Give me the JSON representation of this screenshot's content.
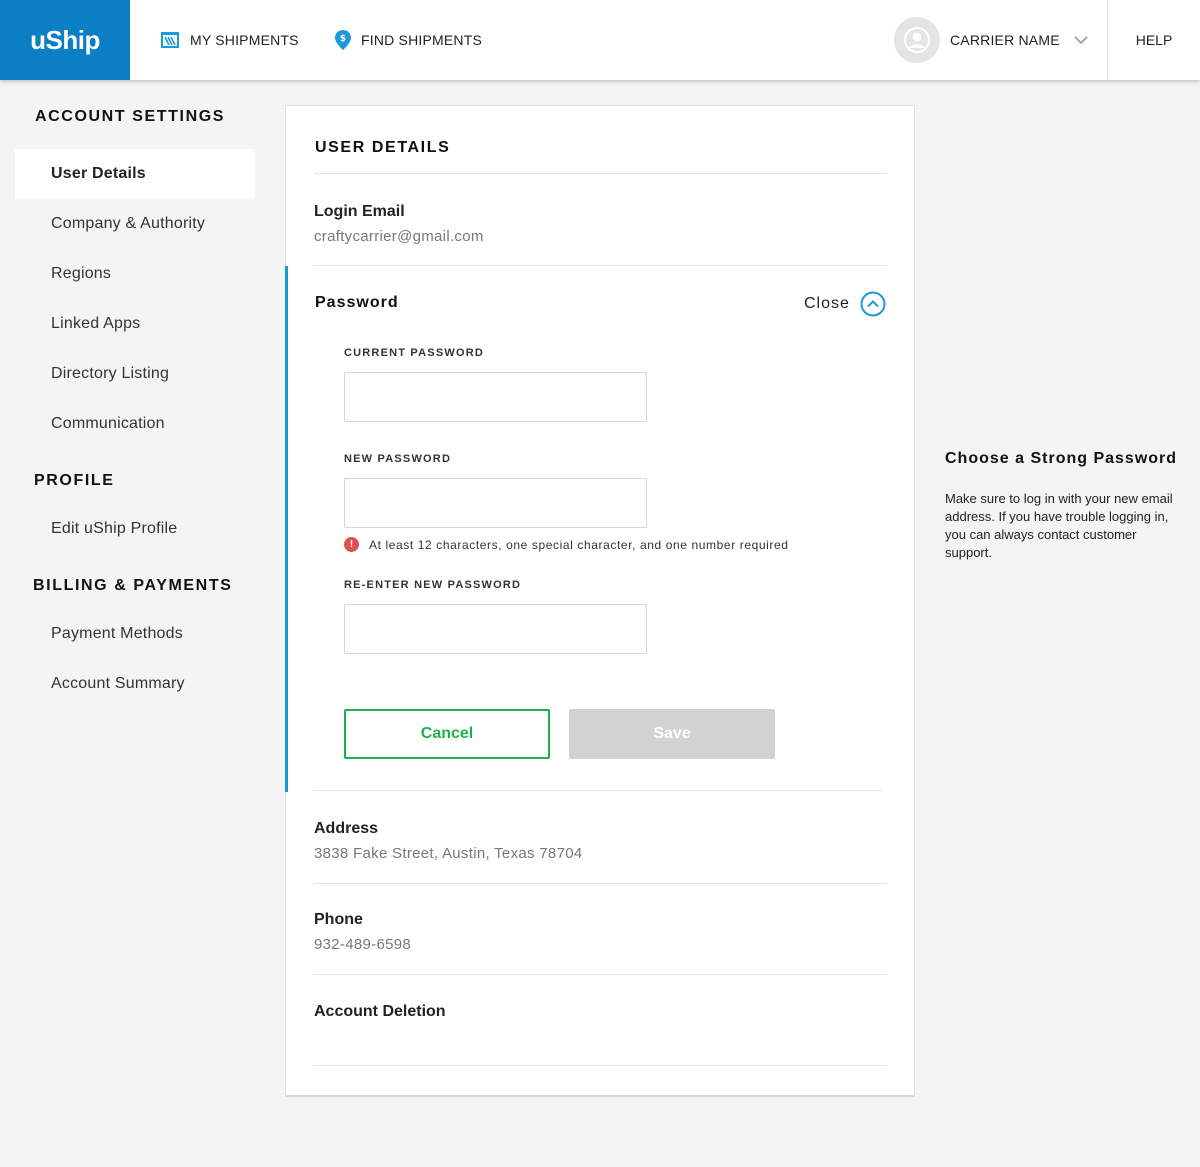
{
  "header": {
    "logo_text": "uShip",
    "nav": [
      {
        "label": "MY SHIPMENTS",
        "icon": "shipments-icon"
      },
      {
        "label": "FIND SHIPMENTS",
        "icon": "location-pin-dollar-icon"
      }
    ],
    "user_name": "CARRIER NAME",
    "help_label": "HELP",
    "brand_color": "#0a7fc4"
  },
  "sidebar": {
    "sections": [
      {
        "heading": "ACCOUNT SETTINGS",
        "items": [
          "User Details",
          "Company & Authority",
          "Regions",
          "Linked Apps",
          "Directory Listing",
          "Communication"
        ]
      },
      {
        "heading": "PROFILE",
        "items": [
          "Edit uShip Profile"
        ]
      },
      {
        "heading": "BILLING & PAYMENTS",
        "items": [
          "Payment Methods",
          "Account Summary"
        ]
      }
    ],
    "active_item": "User Details"
  },
  "card": {
    "title": "USER DETAILS",
    "login_email": {
      "label": "Login Email",
      "value": "craftycarrier@gmail.com"
    },
    "password": {
      "title": "Password",
      "close_label": "Close",
      "current_label": "CURRENT PASSWORD",
      "current_value": "",
      "new_label": "NEW PASSWORD",
      "new_value": "",
      "hint": "At least 12 characters, one special character, and one number required",
      "reenter_label": "RE-ENTER NEW PASSWORD",
      "reenter_value": "",
      "cancel_label": "Cancel",
      "save_label": "Save"
    },
    "address": {
      "label": "Address",
      "value": "3838 Fake Street, Austin, Texas 78704"
    },
    "phone": {
      "label": "Phone",
      "value": "932-489-6598"
    },
    "account_deletion": {
      "label": "Account Deletion"
    }
  },
  "tip": {
    "title": "Choose a Strong Password",
    "body": "Make sure to log in with your new email address. If you have trouble logging in, you can always contact customer support."
  },
  "colors": {
    "accent": "#1a9ad6",
    "success": "#1eb24b",
    "error": "#e0504f",
    "disabled": "#d2d2d2"
  }
}
